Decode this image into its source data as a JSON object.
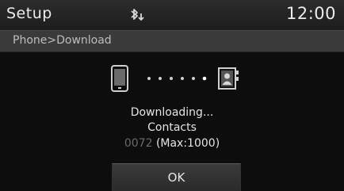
{
  "header": {
    "title": "Setup",
    "status_icon": "bluetooth-download-icon",
    "clock": "12:00"
  },
  "breadcrumb": {
    "text": "Phone>Download"
  },
  "download": {
    "source_icon": "phone-icon",
    "target_icon": "contacts-book-icon",
    "status": "Downloading...",
    "item": "Contacts",
    "count": "0072",
    "max_label": "(Max:1000)"
  },
  "buttons": {
    "ok_label": "OK"
  },
  "colors": {
    "background": "#0c0c0c",
    "header_bg": "#262626",
    "breadcrumb_bg": "#3a3a3a",
    "text": "#e8e8e8",
    "count_text": "#6a6a6a"
  }
}
